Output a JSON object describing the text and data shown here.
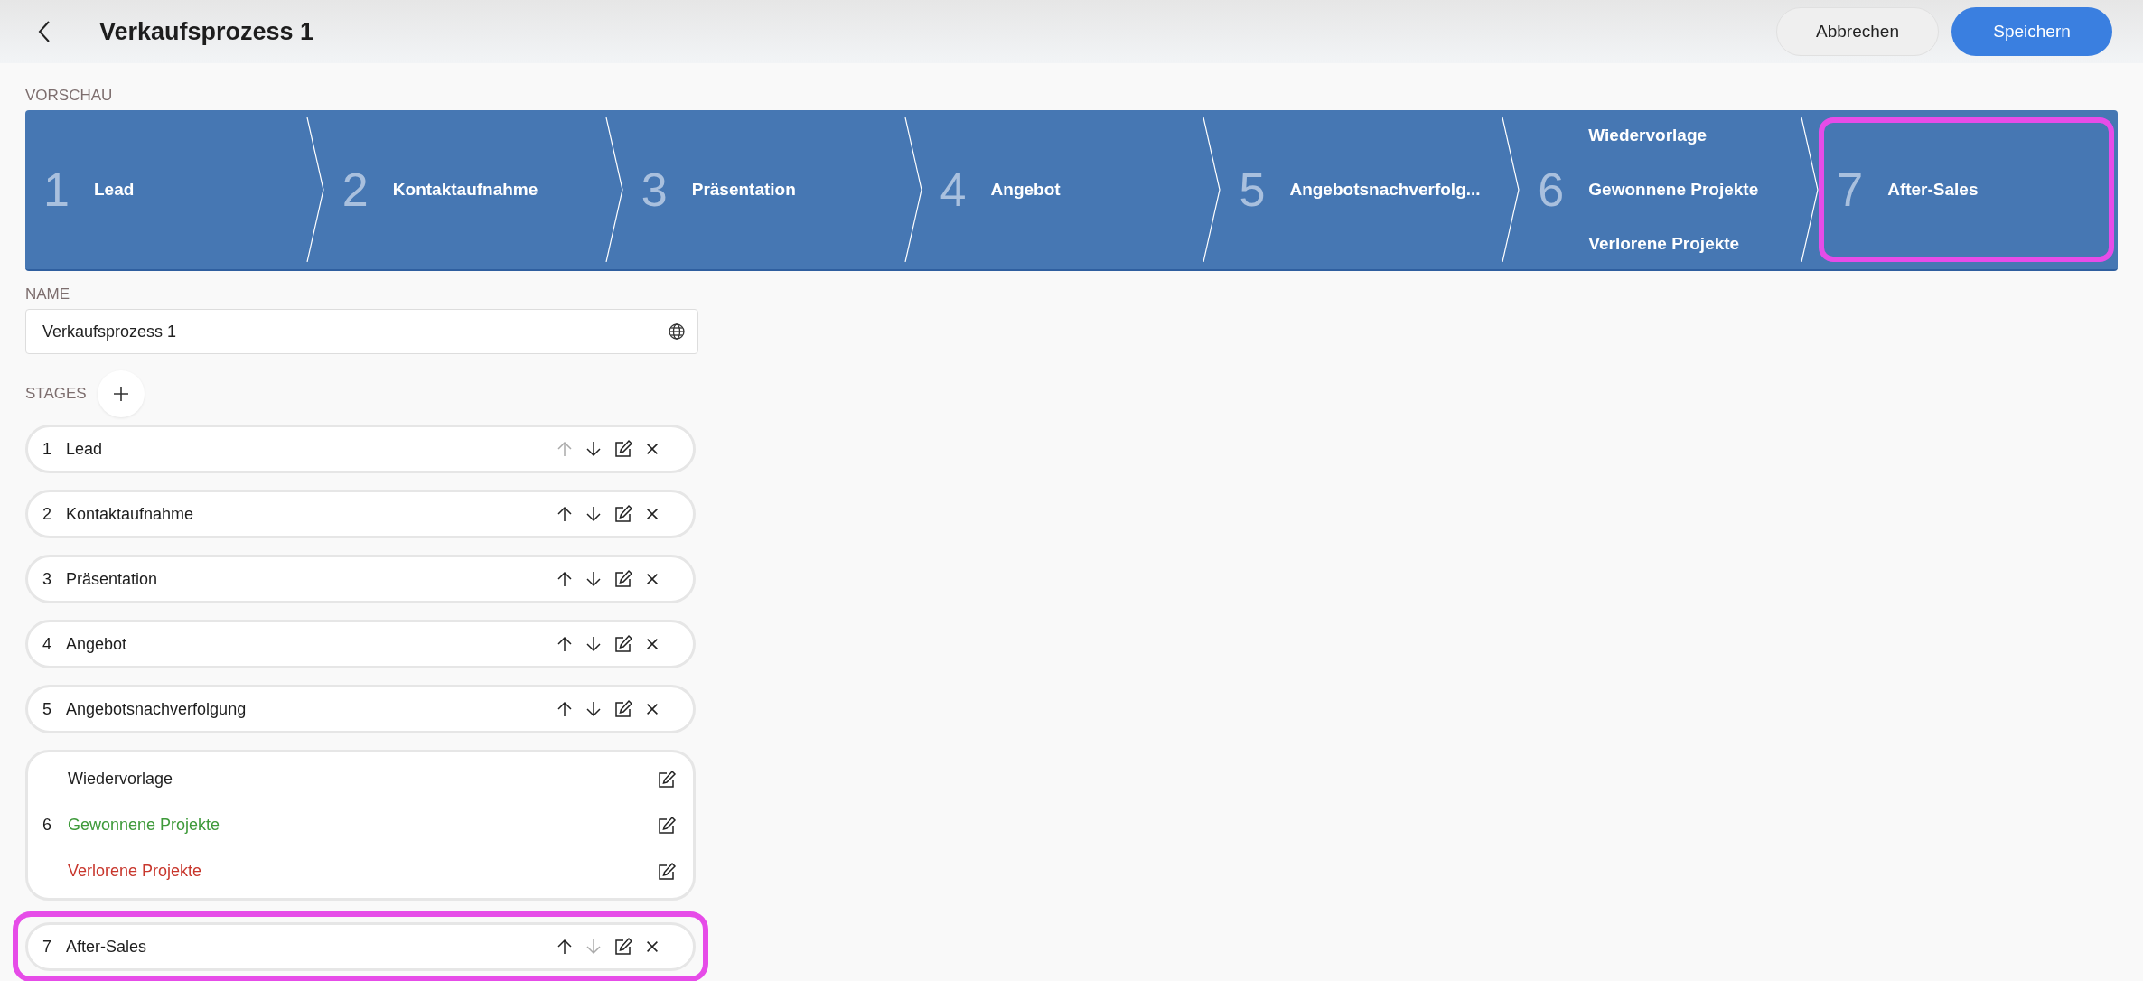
{
  "header": {
    "title": "Verkaufsprozess 1",
    "buttons": [
      {
        "label": "Abbrechen",
        "kind": "secondary"
      },
      {
        "label": "Speichern",
        "kind": "primary"
      }
    ]
  },
  "preview": {
    "label": "VORSCHAU",
    "stages": [
      {
        "number": "1",
        "labels": [
          "Lead"
        ],
        "highlighted": false
      },
      {
        "number": "2",
        "labels": [
          "Kontaktaufnahme"
        ],
        "highlighted": false
      },
      {
        "number": "3",
        "labels": [
          "Präsentation"
        ],
        "highlighted": false
      },
      {
        "number": "4",
        "labels": [
          "Angebot"
        ],
        "highlighted": false
      },
      {
        "number": "5",
        "labels": [
          "Angebotsnachverfolg..."
        ],
        "highlighted": false
      },
      {
        "number": "6",
        "labels": [
          "Wiedervorlage",
          "Gewonnene Projekte",
          "Verlorene Projekte"
        ],
        "highlighted": false
      },
      {
        "number": "7",
        "labels": [
          "After-Sales"
        ],
        "highlighted": true
      }
    ]
  },
  "name_field": {
    "label": "NAME",
    "value": "Verkaufsprozess 1"
  },
  "stages_label": "STAGES",
  "stages": [
    {
      "kind": "single",
      "number": "1",
      "name": "Lead",
      "up_disabled": true,
      "down_disabled": false,
      "highlighted": false
    },
    {
      "kind": "single",
      "number": "2",
      "name": "Kontaktaufnahme",
      "up_disabled": false,
      "down_disabled": false,
      "highlighted": false
    },
    {
      "kind": "single",
      "number": "3",
      "name": "Präsentation",
      "up_disabled": false,
      "down_disabled": false,
      "highlighted": false
    },
    {
      "kind": "single",
      "number": "4",
      "name": "Angebot",
      "up_disabled": false,
      "down_disabled": false,
      "highlighted": false
    },
    {
      "kind": "single",
      "number": "5",
      "name": "Angebotsnachverfolgung",
      "up_disabled": false,
      "down_disabled": false,
      "highlighted": false
    },
    {
      "kind": "group",
      "number": "6",
      "outcomes": [
        {
          "name": "Wiedervorlage",
          "color": "#1f1f1f"
        },
        {
          "name": "Gewonnene Projekte",
          "color": "#3e9a3a"
        },
        {
          "name": "Verlorene Projekte",
          "color": "#c8372d"
        }
      ]
    },
    {
      "kind": "single",
      "number": "7",
      "name": "After-Sales",
      "up_disabled": false,
      "down_disabled": true,
      "highlighted": true
    }
  ]
}
